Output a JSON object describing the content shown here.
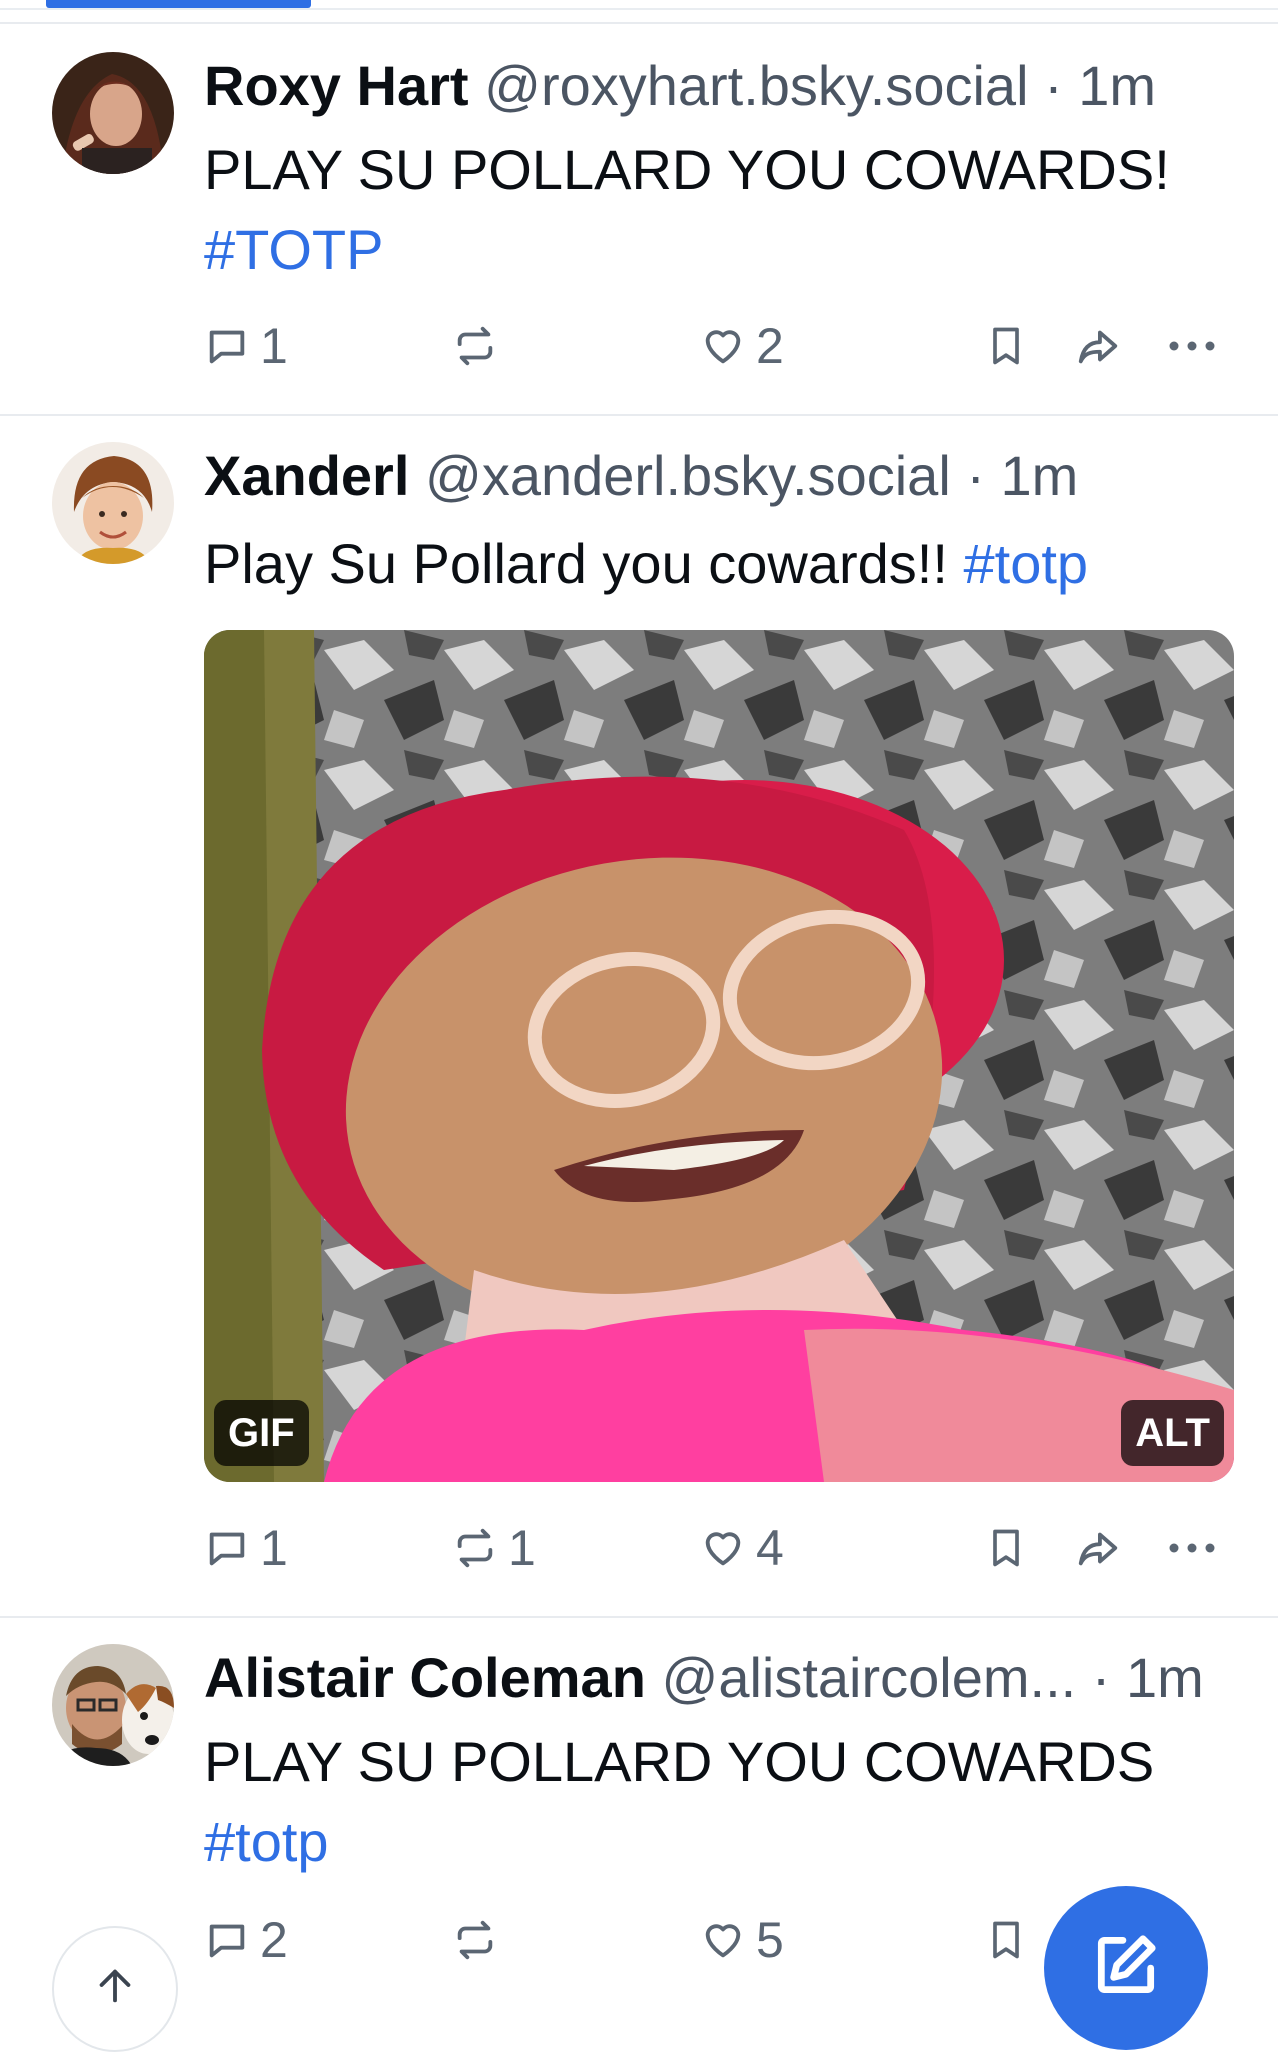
{
  "feed": {
    "posts": [
      {
        "author_name": "Roxy Hart",
        "handle": "@roxyhart.bsky.social",
        "time": "· 1m",
        "text_line1": "PLAY SU POLLARD YOU COWARDS!",
        "hashtag": "#TOTP",
        "reply_count": "1",
        "repost_count": "",
        "like_count": "2"
      },
      {
        "author_name": "Xanderl",
        "handle": "@xanderl.bsky.social",
        "time": "· 1m",
        "text_line1": "Play Su Pollard you cowards!!",
        "hashtag": "#totp",
        "media": {
          "gif_badge": "GIF",
          "alt_badge": "ALT"
        },
        "reply_count": "1",
        "repost_count": "1",
        "like_count": "4"
      },
      {
        "author_name": "Alistair Coleman",
        "handle": "@alistaircolem...",
        "time": "· 1m",
        "text_line1": "PLAY SU POLLARD YOU COWARDS",
        "hashtag": "#totp",
        "reply_count": "2",
        "repost_count": "",
        "like_count": "5"
      }
    ]
  },
  "icons": {
    "reply": "speech-bubble-icon",
    "repost": "repost-icon",
    "like": "heart-icon",
    "bookmark": "bookmark-icon",
    "share": "share-arrow-icon",
    "more": "ellipsis-icon",
    "compose": "compose-icon",
    "scroll_top": "arrow-up-icon"
  },
  "colors": {
    "accent": "#2f6fe4",
    "text": "#0b0f14",
    "muted": "#5b6673"
  }
}
